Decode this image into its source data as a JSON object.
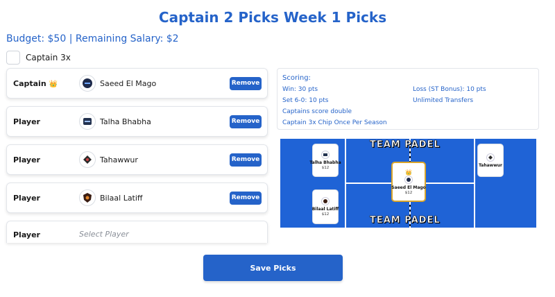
{
  "header": {
    "title": "Captain 2 Picks Week 1 Picks"
  },
  "budget": {
    "text": "Budget: $50 | Remaining Salary: $2"
  },
  "captain3x": {
    "label": "Captain 3x",
    "checked": false
  },
  "slots": [
    {
      "role": "Captain",
      "crown": "👑",
      "name": "Saeed El Mago",
      "remove_label": "Remove",
      "logo": "team-logo-icon"
    },
    {
      "role": "Player",
      "name": "Talha Bhabha",
      "remove_label": "Remove",
      "logo": "team-logo-icon"
    },
    {
      "role": "Player",
      "name": "Tahawwur",
      "remove_label": "Remove",
      "logo": "team-logo-icon"
    },
    {
      "role": "Player",
      "name": "Bilaal Latiff",
      "remove_label": "Remove",
      "logo": "team-logo-icon"
    },
    {
      "role": "Player",
      "placeholder": "Select Player"
    }
  ],
  "scoring": {
    "title": "Scoring:",
    "win": "Win: 30 pts",
    "set": "Set 6-0: 10 pts",
    "captains": "Captains score double",
    "chip": "Captain 3x Chip Once Per Season",
    "loss": "Loss (ST Bonus): 10 pts",
    "transfers": "Unlimited Transfers"
  },
  "court": {
    "banner_top": "TEAM PADEL",
    "banner_bottom": "TEAM PADEL",
    "cards": [
      {
        "name": "Talha Bhabha",
        "salary": "$12"
      },
      {
        "name": "Bilaal Latiff",
        "salary": "$12"
      },
      {
        "name": "Saeed El Mago",
        "salary": "$12",
        "captain": true,
        "crown": "👑"
      },
      {
        "name": "Tahawwur",
        "salary": "$12"
      }
    ],
    "court_color": "#1f63d6"
  },
  "actions": {
    "save_label": "Save Picks"
  },
  "colors": {
    "accent": "#2563c9",
    "captain_border": "#d9a52b"
  }
}
